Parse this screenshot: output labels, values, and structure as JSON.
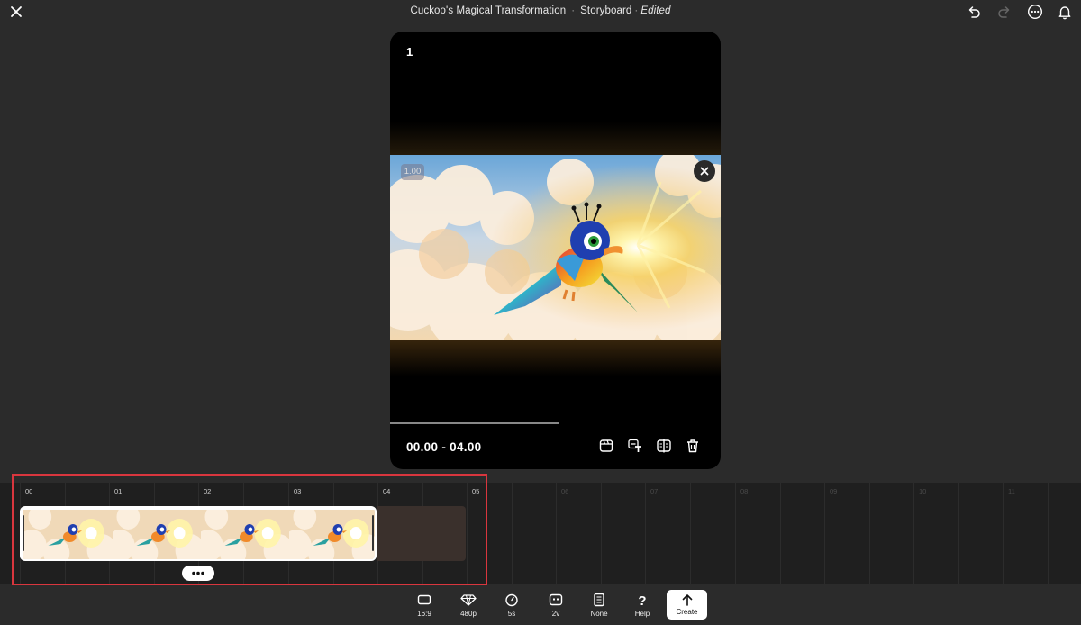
{
  "header": {
    "project_title": "Cuckoo's Magical Transformation",
    "separator": "·",
    "mode": "Storyboard",
    "status": "Edited"
  },
  "panel": {
    "number": "1",
    "scale_badge": "1.00",
    "time_range": "00.00 - 04.00",
    "playback_progress": 0.51
  },
  "timeline": {
    "ticks": [
      "00",
      "01",
      "02",
      "03",
      "04",
      "05",
      "06",
      "07",
      "08",
      "09",
      "10",
      "11"
    ],
    "active_ticks": 6,
    "clip_frames": 4,
    "more_button": "•••"
  },
  "toolbar": {
    "items": [
      {
        "icon": "aspect-ratio-icon",
        "label": "16:9"
      },
      {
        "icon": "quality-diamond-icon",
        "label": "480p"
      },
      {
        "icon": "duration-clock-icon",
        "label": "5s"
      },
      {
        "icon": "video-count-icon",
        "label": "2v"
      },
      {
        "icon": "style-document-icon",
        "label": "None"
      },
      {
        "icon": "help-question-icon",
        "label": "Help"
      }
    ],
    "create_label": "Create"
  },
  "colors": {
    "background": "#2b2b2b",
    "timeline": "#1f1f1f",
    "highlight": "#d9363e",
    "panel": "#000000"
  }
}
